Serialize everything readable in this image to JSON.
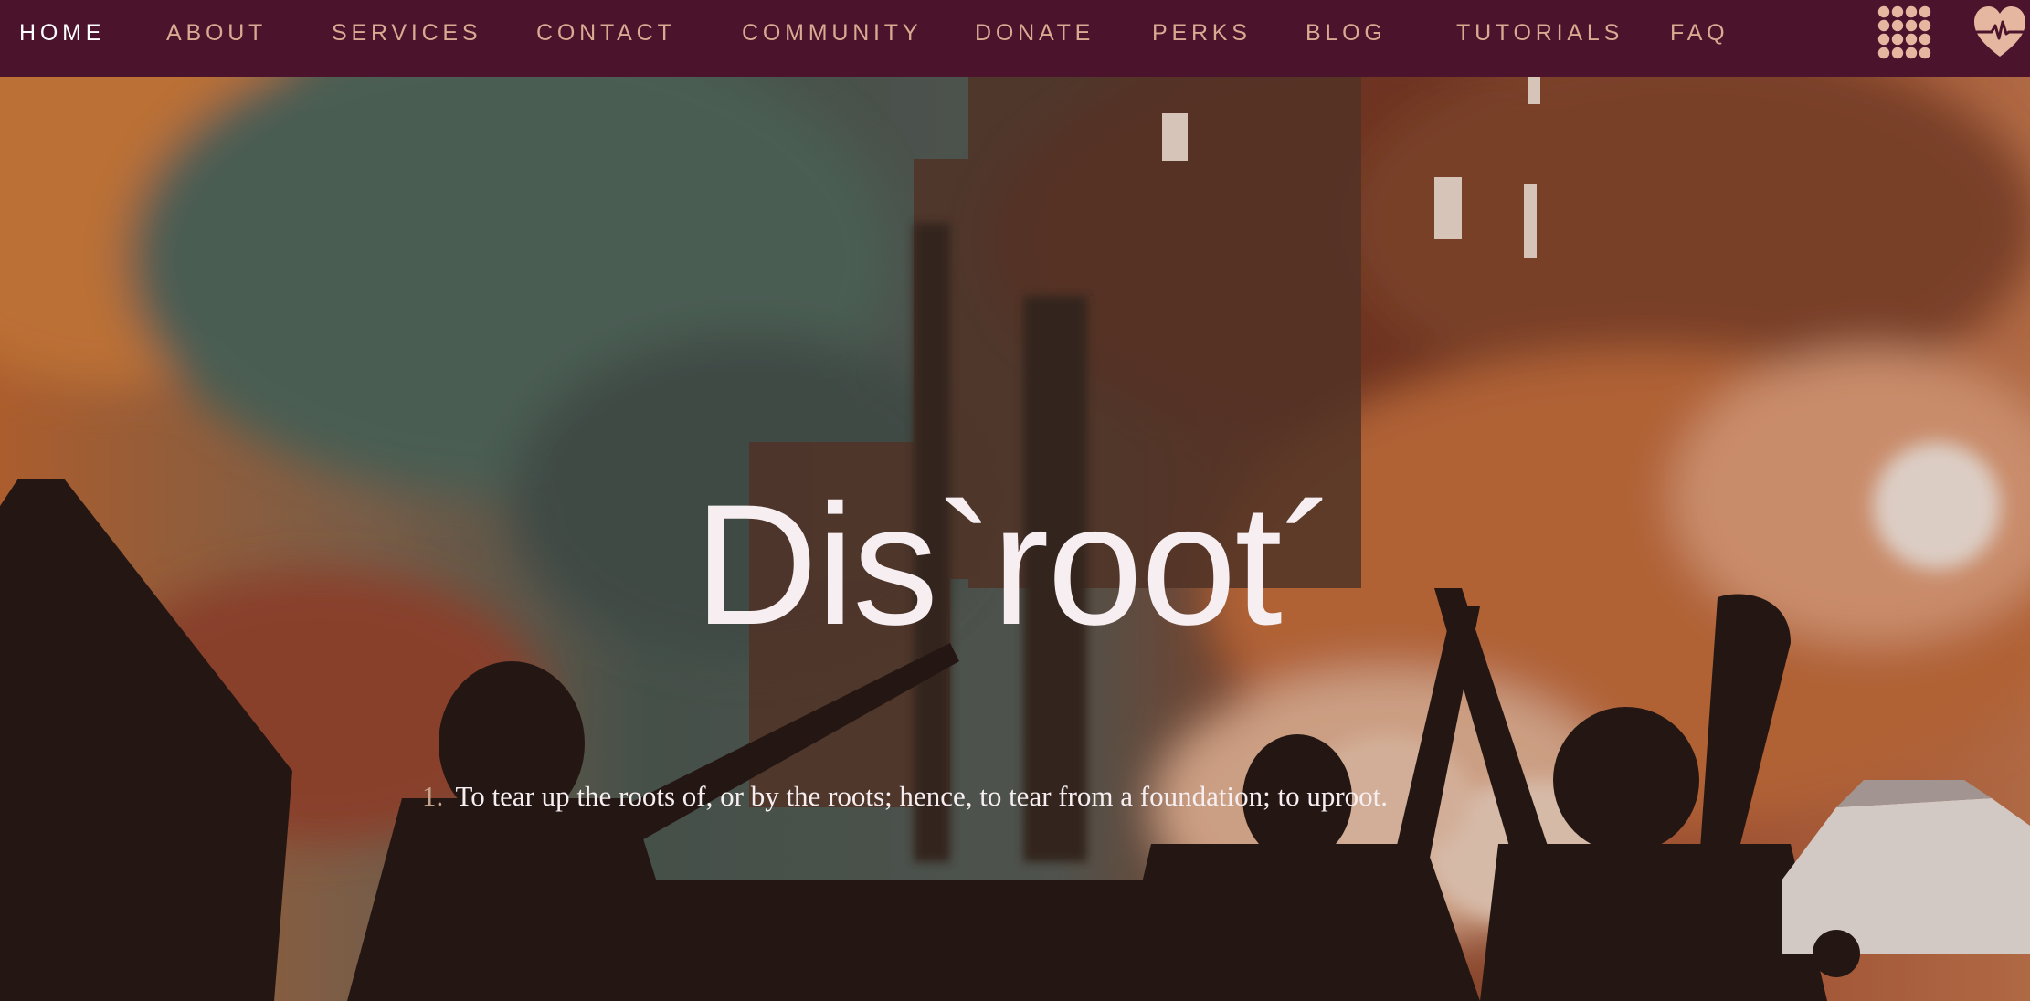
{
  "nav": {
    "items": [
      {
        "label": "HOME",
        "active": true
      },
      {
        "label": "ABOUT",
        "active": false
      },
      {
        "label": "SERVICES",
        "active": false
      },
      {
        "label": "CONTACT",
        "active": false
      },
      {
        "label": "COMMUNITY",
        "active": false
      },
      {
        "label": "DONATE",
        "active": false
      },
      {
        "label": "PERKS",
        "active": false
      },
      {
        "label": "BLOG",
        "active": false
      },
      {
        "label": "TUTORIALS",
        "active": false
      },
      {
        "label": "FAQ",
        "active": false
      }
    ],
    "apps_icon": "apps-grid-icon",
    "status_icon": "heart-pulse-icon"
  },
  "hero": {
    "title": "Dis`root´",
    "definition_number": "1.",
    "definition_text": "To tear up the roots of, or by the roots; hence, to tear from a foundation; to uproot."
  },
  "colors": {
    "nav_background": "#4b132c",
    "nav_text": "#d9aa92",
    "nav_active_text": "#ffffff",
    "icon_color": "#e6b7a0",
    "hero_text": "#f6eef0"
  }
}
